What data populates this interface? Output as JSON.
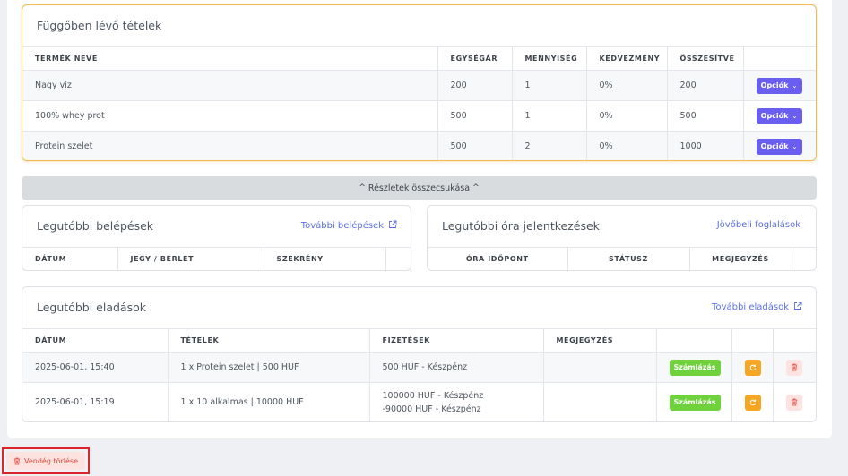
{
  "pending": {
    "title": "Függőben lévő tételek",
    "columns": [
      "TERMÉK NEVE",
      "EGYSÉGÁR",
      "MENNYISÉG",
      "KEDVEZMÉNY",
      "ÖSSZESÍTVE",
      ""
    ],
    "rows": [
      {
        "name": "Nagy víz",
        "price": "200",
        "qty": "1",
        "discount": "0%",
        "total": "200",
        "button": "Opciók"
      },
      {
        "name": "100% whey prot",
        "price": "500",
        "qty": "1",
        "discount": "0%",
        "total": "500",
        "button": "Opciók"
      },
      {
        "name": "Protein szelet",
        "price": "500",
        "qty": "2",
        "discount": "0%",
        "total": "1000",
        "button": "Opciók"
      }
    ]
  },
  "collapse": {
    "label": "Részletek összecsukása"
  },
  "entries": {
    "title": "Legutóbbi belépések",
    "link": "További belépések",
    "columns": [
      "DÁTUM",
      "JEGY / BÉRLET",
      "SZEKRÉNY",
      ""
    ]
  },
  "classes": {
    "title": "Legutóbbi óra jelentkezések",
    "link": "Jövőbeli foglalások",
    "columns": [
      "ÓRA IDŐPONT",
      "STÁTUSZ",
      "MEGJEGYZÉS",
      ""
    ]
  },
  "sales": {
    "title": "Legutóbbi eladások",
    "link": "További eladások",
    "columns": [
      "DÁTUM",
      "TÉTELEK",
      "FIZETÉSEK",
      "MEGJEGYZÉS",
      "",
      "",
      ""
    ],
    "rows": [
      {
        "date": "2025-06-01, 15:40",
        "items": "1 x Protein szelet | 500 HUF",
        "payment_1": "500 HUF - Készpénz",
        "payment_2": "",
        "note": "",
        "invoice": "Számlázás"
      },
      {
        "date": "2025-06-01, 15:19",
        "items": "1 x 10 alkalmas | 10000 HUF",
        "payment_1": "100000 HUF - Készpénz",
        "payment_2": "-90000 HUF - Készpénz",
        "note": "",
        "invoice": "Számlázás"
      }
    ]
  },
  "delete_guest": {
    "label": "Vendég törlése"
  },
  "colors": {
    "accent": "#6a5ef0",
    "link": "#5a6fe0",
    "pending_border": "#f1b94f",
    "invoice": "#6fd13b",
    "refresh": "#f5a623",
    "danger": "#e0443e"
  }
}
